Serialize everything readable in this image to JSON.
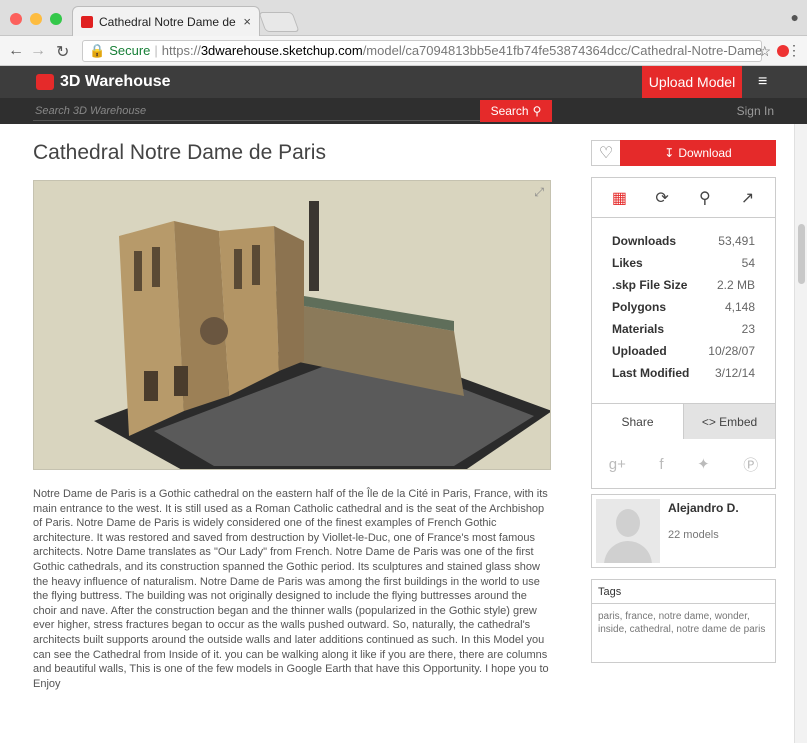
{
  "browser": {
    "tab_title": "Cathedral Notre Dame de Paris",
    "tab_close": "×",
    "secure_label": "Secure",
    "url_scheme": "https://",
    "url_host": "3dwarehouse.sketchup.com",
    "url_path": "/model/ca7094813bb5e41fb74fe53874364dcc/Cathedral-Notre-Dame-de...",
    "icons": [
      "back-icon",
      "forward-icon",
      "reload-icon",
      "lock-icon",
      "star-icon",
      "extension-icon",
      "menu-icon",
      "profile-icon"
    ]
  },
  "site": {
    "logo_text": "3D Warehouse",
    "upload_label": "Upload Model",
    "search_placeholder": "Search 3D Warehouse",
    "search_label": "Search",
    "signin_label": "Sign In",
    "accent_color": "#e52a2a"
  },
  "model": {
    "title": "Cathedral Notre Dame de Paris",
    "description": "Notre Dame de Paris is a Gothic cathedral on the eastern half of the Île de la Cité in Paris, France, with its main entrance to the west. It is still used as a Roman Catholic cathedral and is the seat of the Archbishop of Paris. Notre Dame de Paris is widely considered one of the finest examples of French Gothic architecture. It was restored and saved from destruction by Viollet-le-Duc, one of France's most famous architects. Notre Dame translates as \"Our Lady\" from French. Notre Dame de Paris was one of the first Gothic cathedrals, and its construction spanned the Gothic period. Its sculptures and stained glass show the heavy influence of naturalism. Notre Dame de Paris was among the first buildings in the world to use the flying buttress. The building was not originally designed to include the flying buttresses around the choir and nave. After the construction began and the thinner walls (popularized in the Gothic style) grew ever higher, stress fractures began to occur as the walls pushed outward. So, naturally, the cathedral's architects built supports around the outside walls and later additions continued as such. In this Model you can see the Cathedral from Inside of it. you can be walking along it like if you are there, there are columns and beautiful walls, This is one of the few models in Google Earth that have this Opportunity. I hope you to Enjoy"
  },
  "sidebar": {
    "download_label": "Download",
    "view_icons": [
      "image-icon",
      "3d-rotate-icon",
      "location-icon",
      "chart-icon"
    ],
    "stats": [
      {
        "label": "Downloads",
        "value": "53,491"
      },
      {
        "label": "Likes",
        "value": "54"
      },
      {
        "label": ".skp File Size",
        "value": "2.2 MB"
      },
      {
        "label": "Polygons",
        "value": "4,148"
      },
      {
        "label": "Materials",
        "value": "23"
      },
      {
        "label": "Uploaded",
        "value": "10/28/07"
      },
      {
        "label": "Last Modified",
        "value": "3/12/14"
      }
    ],
    "share_label": "Share",
    "embed_label": "<> Embed",
    "social_icons": [
      "google-plus-icon",
      "facebook-icon",
      "twitter-icon",
      "pinterest-icon"
    ]
  },
  "author": {
    "name": "Alejandro D.",
    "models": "22 models"
  },
  "tags": {
    "heading": "Tags",
    "text": "paris, france, notre dame, wonder, inside, cathedral, notre dame de paris"
  }
}
